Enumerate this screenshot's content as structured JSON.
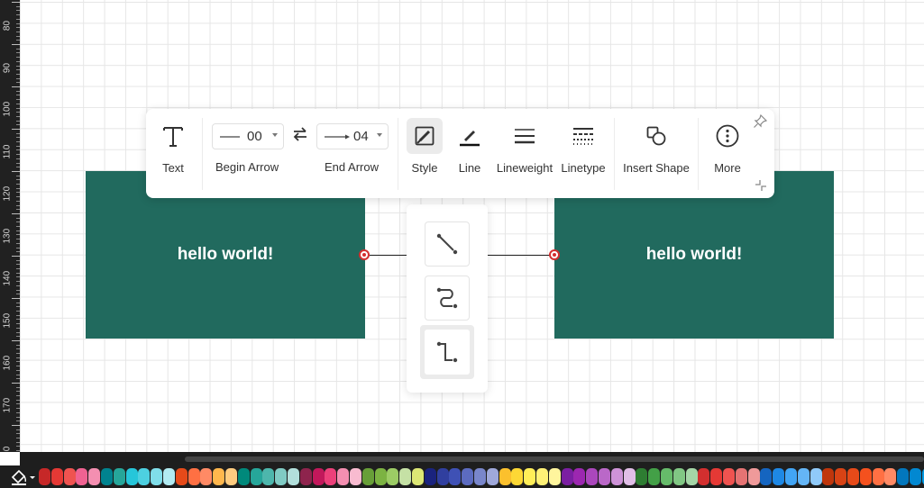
{
  "ruler": {
    "labels": [
      "80",
      "90",
      "100",
      "110",
      "120",
      "130",
      "140",
      "150",
      "160",
      "170",
      "0"
    ]
  },
  "canvas": {
    "shapes": [
      {
        "text": "hello world!",
        "fill": "#216a5e"
      },
      {
        "text": "hello world!",
        "fill": "#216a5e"
      }
    ],
    "connector": {
      "line_color": "#222222",
      "endpoint_color": "#d32f2f"
    }
  },
  "toolbar": {
    "text_label": "Text",
    "begin_arrow": {
      "value": "00",
      "label": "Begin Arrow"
    },
    "end_arrow": {
      "value": "04",
      "label": "End Arrow"
    },
    "style_label": "Style",
    "line_label": "Line",
    "lineweight_label": "Lineweight",
    "linetype_label": "Linetype",
    "insert_shape_label": "Insert Shape",
    "more_label": "More"
  },
  "connector_types": [
    {
      "icon": "straight-connector-icon",
      "selected": false
    },
    {
      "icon": "curved-connector-icon",
      "selected": false
    },
    {
      "icon": "elbow-connector-icon",
      "selected": true
    }
  ],
  "palette": {
    "colors": [
      "#c62828",
      "#e53935",
      "#ef5350",
      "#f06292",
      "#f48fb1",
      "#00838f",
      "#26a69a",
      "#26c6da",
      "#4dd0e1",
      "#80deea",
      "#b2ebf2",
      "#e64a19",
      "#ff7043",
      "#ff8a65",
      "#ffb74d",
      "#ffcc80",
      "#00897b",
      "#26a69a",
      "#4db6ac",
      "#80cbc4",
      "#b2dfdb",
      "#8e244d",
      "#c2185b",
      "#ec407a",
      "#f48fb1",
      "#f8bbd0",
      "#689f38",
      "#7cb342",
      "#9ccc65",
      "#c5e1a5",
      "#dce775",
      "#1a237e",
      "#303f9f",
      "#3f51b5",
      "#5c6bc0",
      "#7986cb",
      "#9fa8da",
      "#fbc02d",
      "#fdd835",
      "#ffee58",
      "#fff176",
      "#fff59d",
      "#7b1fa2",
      "#9c27b0",
      "#ab47bc",
      "#ba68c8",
      "#ce93d8",
      "#e1bee7",
      "#2e7d32",
      "#43a047",
      "#66bb6a",
      "#81c784",
      "#a5d6a7",
      "#d32f2f",
      "#e53935",
      "#ef5350",
      "#e57373",
      "#ef9a9a",
      "#1565c0",
      "#1e88e5",
      "#42a5f5",
      "#64b5f6",
      "#90caf9",
      "#bf360c",
      "#d84315",
      "#e64a19",
      "#f4511e",
      "#ff7043",
      "#ff8a65",
      "#0277bd",
      "#0288d1",
      "#039be5",
      "#29b6f6",
      "#4fc3f7",
      "#81d4fa",
      "#6d4c41"
    ]
  }
}
